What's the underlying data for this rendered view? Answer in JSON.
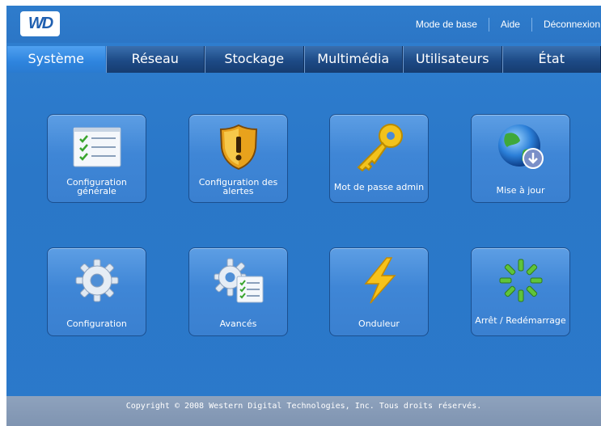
{
  "logo": {
    "text": "WD"
  },
  "top_links": [
    "Mode de base",
    "Aide",
    "Déconnexion"
  ],
  "tabs": [
    {
      "label": "Système",
      "active": true
    },
    {
      "label": "Réseau",
      "active": false
    },
    {
      "label": "Stockage",
      "active": false
    },
    {
      "label": "Multimédia",
      "active": false
    },
    {
      "label": "Utilisateurs",
      "active": false
    },
    {
      "label": "État",
      "active": false
    }
  ],
  "tiles": [
    {
      "label": "Configuration générale",
      "icon": "checklist-icon"
    },
    {
      "label": "Configuration des alertes",
      "icon": "warning-shield-icon"
    },
    {
      "label": "Mot de passe admin",
      "icon": "key-icon"
    },
    {
      "label": "Mise à jour",
      "icon": "globe-download-icon"
    },
    {
      "label": "Configuration",
      "icon": "gear-icon"
    },
    {
      "label": "Avancés",
      "icon": "gears-checklist-icon"
    },
    {
      "label": "Onduleur",
      "icon": "lightning-icon"
    },
    {
      "label": "Arrêt / Redémarrage",
      "icon": "restart-spinner-icon"
    }
  ],
  "footer": {
    "text": "Copyright © 2008 Western Digital Technologies, Inc. Tous droits réservés."
  },
  "colors": {
    "background": "#2b79ca",
    "tab_active": "#2e84de",
    "tab_inactive": "#1d4a86",
    "footer": "#8ea2bd"
  }
}
